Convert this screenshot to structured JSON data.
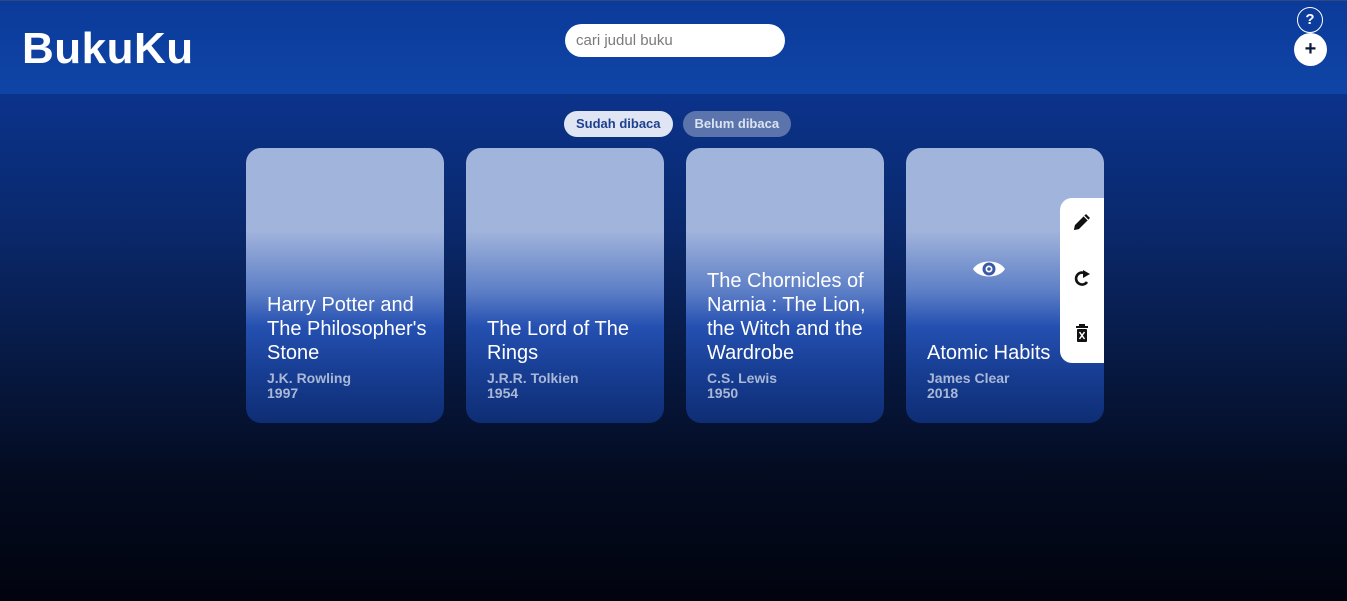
{
  "header": {
    "brand": "BukuKu",
    "search_placeholder": "cari judul buku",
    "help_label": "?",
    "add_label": "+"
  },
  "tabs": [
    {
      "label": "Sudah dibaca",
      "active": true
    },
    {
      "label": "Belum dibaca",
      "active": false
    }
  ],
  "books": [
    {
      "title": "Harry Potter and The Philosopher's Stone",
      "author": "J.K. Rowling",
      "year": "1997"
    },
    {
      "title": "The Lord of The Rings",
      "author": "J.R.R. Tolkien",
      "year": "1954"
    },
    {
      "title": "The Chornicles of Narnia : The Lion, the Witch and the Wardrobe",
      "author": "C.S. Lewis",
      "year": "1950"
    },
    {
      "title": "Atomic Habits",
      "author": "James Clear",
      "year": "2018"
    }
  ],
  "hover_actions": {
    "icons": [
      "pencil-icon",
      "redo-icon",
      "trash-icon"
    ],
    "view_icon": "eye-icon"
  },
  "colors": {
    "header_bg": "#0f45a6",
    "tab_active_bg": "#dfe5f3",
    "tab_inactive_bg": "#5b75ac"
  }
}
